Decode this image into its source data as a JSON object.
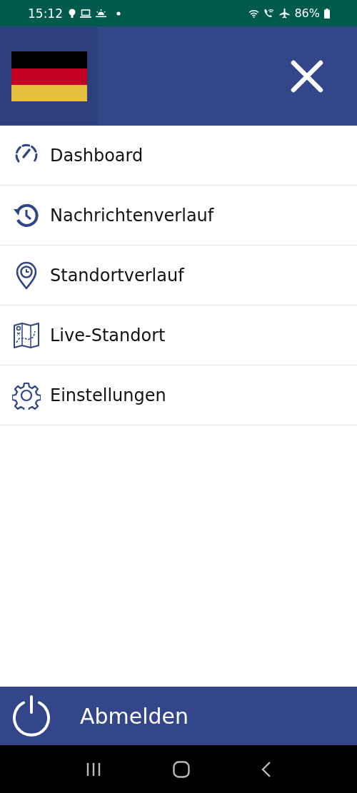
{
  "status_bar": {
    "time": "15:12",
    "battery": "86%"
  },
  "menu": {
    "items": [
      {
        "label": "Dashboard",
        "kind": "dashboard"
      },
      {
        "label": "Nachrichtenverlauf",
        "kind": "history"
      },
      {
        "label": "Standortverlauf",
        "kind": "location"
      },
      {
        "label": "Live-Standort",
        "kind": "map"
      },
      {
        "label": "Einstellungen",
        "kind": "settings"
      }
    ]
  },
  "logout": {
    "label": "Abmelden"
  }
}
